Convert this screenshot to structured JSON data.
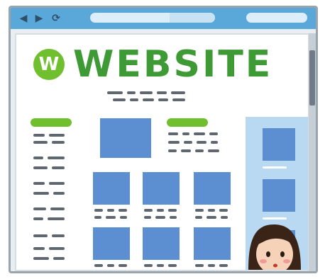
{
  "browser": {
    "back_icon": "back-arrow-icon",
    "forward_icon": "forward-arrow-icon",
    "reload_icon": "reload-icon"
  },
  "website": {
    "logo_mark": "W",
    "logo_text": "WEBSITE"
  },
  "colors": {
    "titlebar": "#5aa8da",
    "logo_green": "#3e9a34",
    "accent_green": "#6fbf2f",
    "tile_blue": "#5b8fd1",
    "sidebar_blue": "#b9d9f2"
  }
}
